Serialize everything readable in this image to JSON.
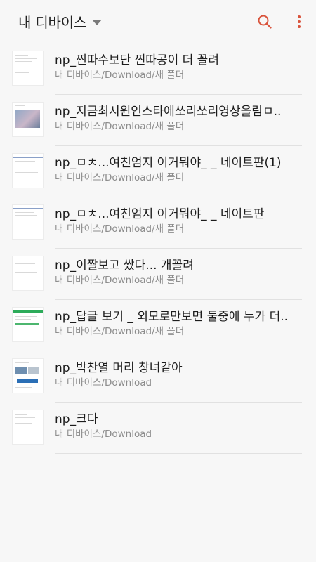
{
  "appbar": {
    "title": "내 디바이스",
    "search_icon": "search-icon",
    "more_icon": "more-vert-icon",
    "accent_color": "#d9533b"
  },
  "files": [
    {
      "name": "np_찐따수보단 찐따공이 더 꼴려",
      "path": "내 디바이스/Download/새 폴더"
    },
    {
      "name": "np_지금최시원인스타에쏘리쏘리영상올림ㅁ..",
      "path": "내 디바이스/Download/새 폴더"
    },
    {
      "name": "np_ㅁㅊ...여친엄지 이거뭐야_ _ 네이트판(1)",
      "path": "내 디바이스/Download/새 폴더"
    },
    {
      "name": "np_ㅁㅊ...여친엄지 이거뭐야_ _ 네이트판",
      "path": "내 디바이스/Download/새 폴더"
    },
    {
      "name": "np_이짤보고 쌌다... 개꼴려",
      "path": "내 디바이스/Download/새 폴더"
    },
    {
      "name": "np_답글 보기 _ 외모로만보면 둘중에 누가 더..",
      "path": "내 디바이스/Download/새 폴더"
    },
    {
      "name": "np_박찬열 머리 창녀같아",
      "path": "내 디바이스/Download"
    },
    {
      "name": "np_크다",
      "path": "내 디바이스/Download"
    }
  ]
}
